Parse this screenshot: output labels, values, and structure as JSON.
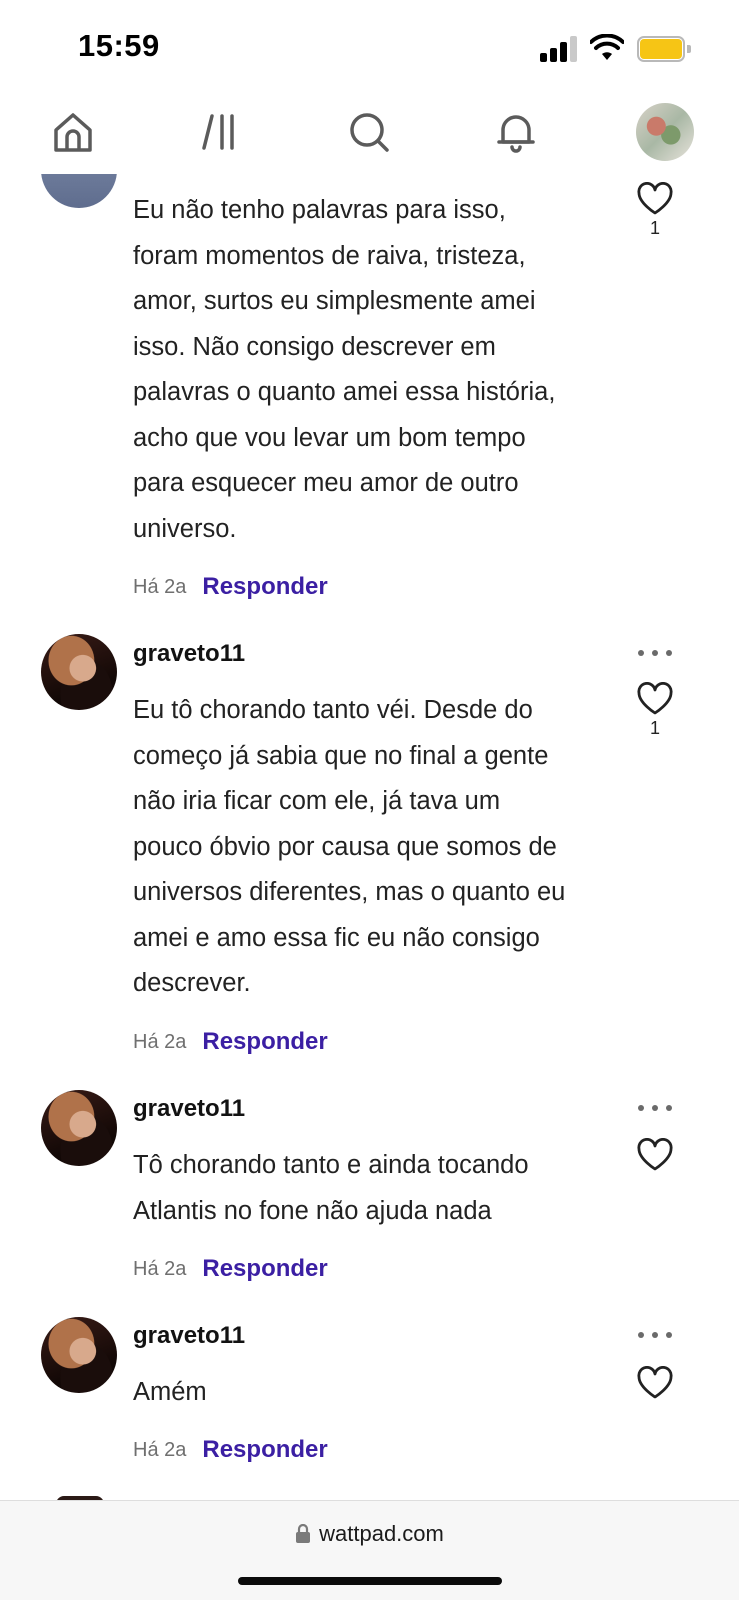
{
  "status_bar": {
    "time": "15:59",
    "battery_color": "#f6c515"
  },
  "nav": {
    "items": [
      {
        "icon": "home-icon"
      },
      {
        "icon": "library-icon"
      },
      {
        "icon": "search-icon"
      },
      {
        "icon": "notifications-icon"
      },
      {
        "icon": "profile-avatar"
      }
    ]
  },
  "comments": [
    {
      "username": "",
      "text": "Eu não tenho palavras para isso, foram momentos de raiva, tristeza, amor, surtos eu simplesmente amei isso. Não consigo descrever em palavras o quanto amei essa história, acho que vou levar um bom tempo para esquecer meu amor de outro universo.",
      "time": "Há 2a",
      "reply": "Responder",
      "likes": "1"
    },
    {
      "username": "graveto11",
      "text": "Eu tô chorando tanto véi. Desde do começo já sabia que no final a gente não iria ficar com ele, já tava um pouco óbvio por causa que somos de universos diferentes, mas o quanto eu amei e amo essa fic eu não consigo descrever.",
      "time": "Há 2a",
      "reply": "Responder",
      "likes": "1"
    },
    {
      "username": "graveto11",
      "text": "Tô chorando tanto e ainda tocando Atlantis no fone não ajuda nada",
      "time": "Há 2a",
      "reply": "Responder",
      "likes": ""
    },
    {
      "username": "graveto11",
      "text": "Amém",
      "time": "Há 2a",
      "reply": "Responder",
      "likes": ""
    }
  ],
  "browser": {
    "url": "wattpad.com"
  },
  "colors": {
    "accent": "#3b1fa3",
    "meta": "#6f6f6f"
  }
}
